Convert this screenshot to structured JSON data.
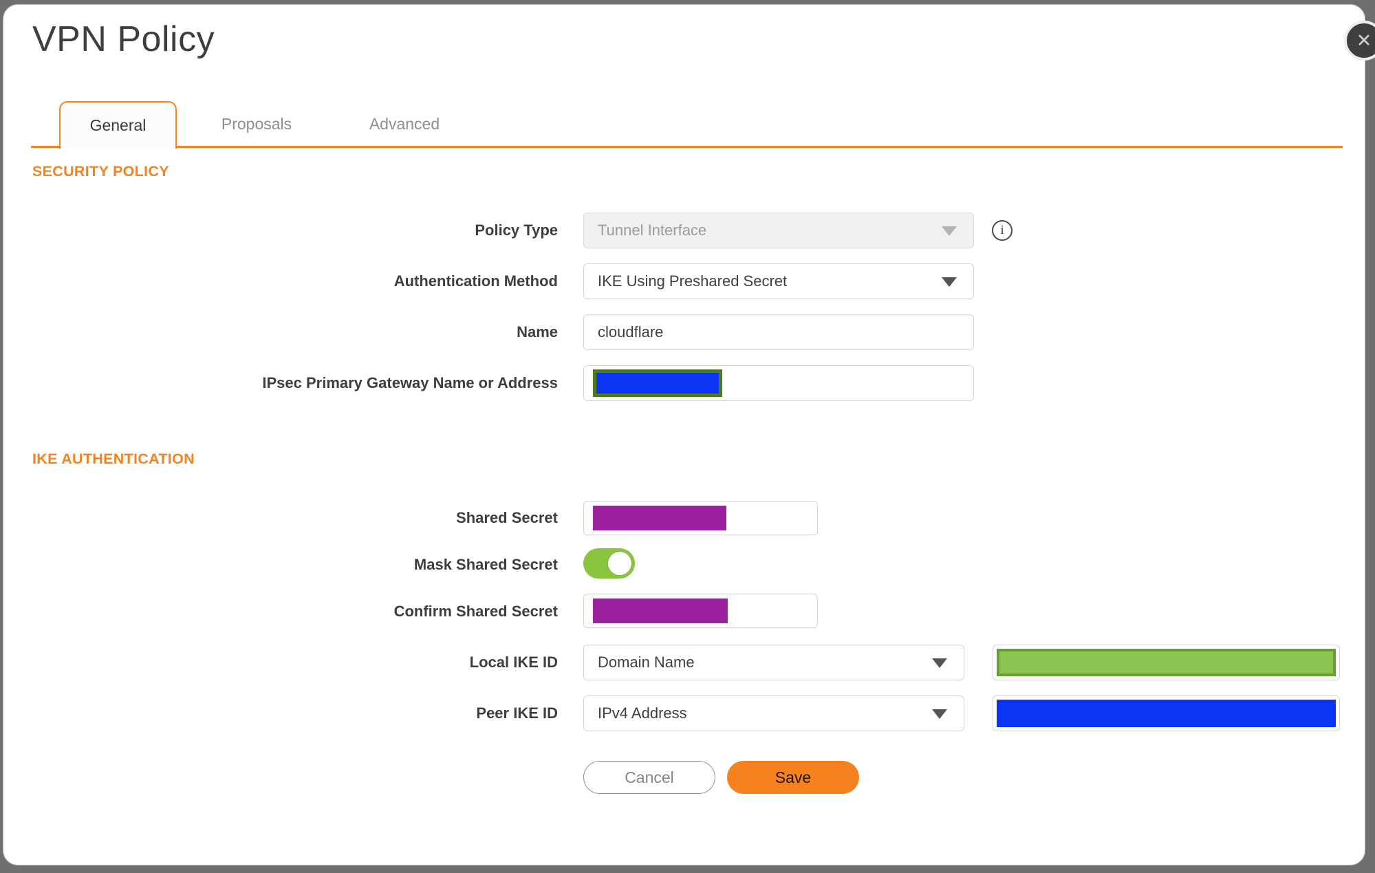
{
  "dialog": {
    "title": "VPN Policy"
  },
  "icons": {
    "close": "✕",
    "info": "i"
  },
  "tabs": [
    {
      "label": "General",
      "active": true
    },
    {
      "label": "Proposals",
      "active": false
    },
    {
      "label": "Advanced",
      "active": false
    }
  ],
  "sections": {
    "security_policy": {
      "heading": "SECURITY POLICY",
      "fields": {
        "policy_type": {
          "label": "Policy Type",
          "value": "Tunnel Interface",
          "disabled": true
        },
        "auth_method": {
          "label": "Authentication Method",
          "value": "IKE Using Preshared Secret"
        },
        "name": {
          "label": "Name",
          "value": "cloudflare"
        },
        "gateway": {
          "label": "IPsec Primary Gateway Name or Address",
          "value": "",
          "redacted": true
        }
      }
    },
    "ike_authentication": {
      "heading": "IKE AUTHENTICATION",
      "fields": {
        "shared_secret": {
          "label": "Shared Secret",
          "value": "",
          "redacted": true
        },
        "mask_shared_secret": {
          "label": "Mask Shared Secret",
          "state": "on"
        },
        "confirm_shared_secret": {
          "label": "Confirm Shared Secret",
          "value": "",
          "redacted": true
        },
        "local_ike_id": {
          "label": "Local IKE ID",
          "value": "Domain Name",
          "id_value_redacted": true
        },
        "peer_ike_id": {
          "label": "Peer IKE ID",
          "value": "IPv4 Address",
          "id_value_redacted": true
        }
      }
    }
  },
  "buttons": {
    "cancel": "Cancel",
    "save": "Save"
  },
  "colors": {
    "accent_orange": "#F6821F",
    "redact_blue": "#0B35F0",
    "redact_purple": "#9C21A0",
    "redact_green_fill": "#8DC454",
    "redact_green_border": "#64A030",
    "redact_olive_border": "#4C7A1E",
    "toggle_green": "#8AC33E",
    "backdrop_gray": "#6F6F6F"
  }
}
